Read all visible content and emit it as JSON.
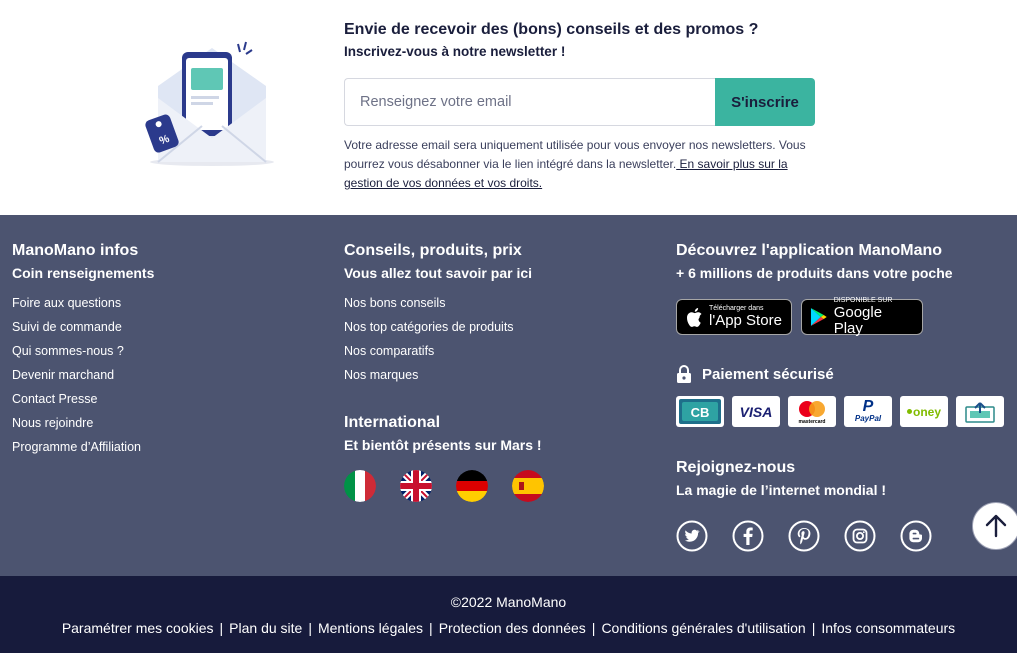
{
  "newsletter": {
    "title": "Envie de recevoir des (bons) conseils et des promos ?",
    "subtitle": "Inscrivez-vous à notre newsletter !",
    "email_placeholder": "Renseignez votre email",
    "email_value": "",
    "submit_label": "S'inscrire",
    "legal_text": "Votre adresse email sera uniquement utilisée pour vous envoyer nos newsletters. Vous pourrez vous désabonner via le lien intégré dans la newsletter.",
    "legal_link": " En savoir plus sur la gestion de vos données et vos droits."
  },
  "infos": {
    "title": "ManoMano infos",
    "subtitle": "Coin renseignements",
    "links": [
      "Foire aux questions",
      "Suivi de commande",
      "Qui sommes-nous ?",
      "Devenir marchand",
      "Contact Presse",
      "Nous rejoindre",
      "Programme d’Affiliation"
    ]
  },
  "conseils": {
    "title": "Conseils, produits, prix",
    "subtitle": "Vous allez tout savoir par ici",
    "links": [
      "Nos bons conseils",
      "Nos top catégories de produits",
      "Nos comparatifs",
      "Nos marques"
    ]
  },
  "international": {
    "title": "International",
    "subtitle": "Et bientôt présents sur Mars !",
    "flags": [
      "italy-flag",
      "uk-flag",
      "germany-flag",
      "spain-flag"
    ]
  },
  "app": {
    "title": "Découvrez l'application ManoMano",
    "subtitle": "+ 6 millions de produits dans votre poche",
    "appstore_small": "Télécharger dans",
    "appstore_big": "l'App Store",
    "googleplay_small": "DISPONIBLE SUR",
    "googleplay_big": "Google Play"
  },
  "payment": {
    "title": "Paiement sécurisé",
    "cards": {
      "cb": "CB",
      "visa": "VISA",
      "mastercard": "mastercard",
      "paypal": "PayPal",
      "oney": "oney"
    }
  },
  "join": {
    "title": "Rejoignez-nous",
    "subtitle": "La magie de l’internet mondial !",
    "socials": [
      "twitter-icon",
      "facebook-icon",
      "pinterest-icon",
      "instagram-icon",
      "blogger-icon"
    ]
  },
  "bottom": {
    "copyright": "©2022 ManoMano",
    "links": [
      "Paramétrer mes cookies",
      "Plan du site",
      "Mentions légales",
      "Protection des données",
      "Conditions générales d'utilisation",
      "Infos consommateurs"
    ],
    "separator": "|"
  },
  "colors": {
    "accent": "#3bb4a0",
    "footer_bg": "#4c5470",
    "bottom_bg": "#171b3c"
  }
}
